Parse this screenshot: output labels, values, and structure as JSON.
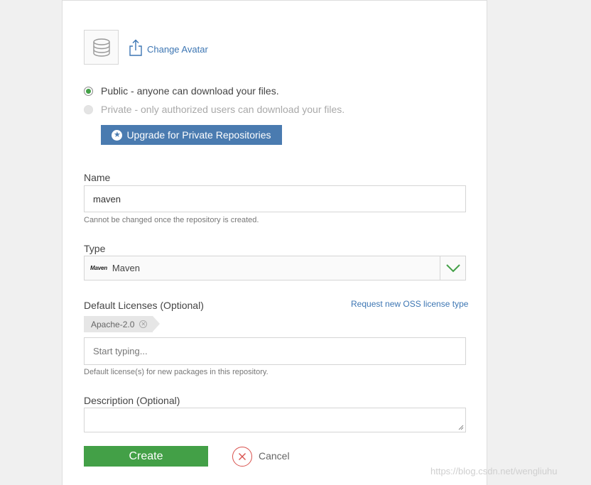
{
  "avatar": {
    "icon": "database-icon",
    "change_label": "Change Avatar"
  },
  "visibility": {
    "public_label": "Public - anyone can download your files.",
    "public_selected": true,
    "private_label": "Private - only authorized users can download your files.",
    "private_enabled": false,
    "upgrade_label": "Upgrade for Private Repositories"
  },
  "name": {
    "label": "Name",
    "value": "maven",
    "hint": "Cannot be changed once the repository is created."
  },
  "type": {
    "label": "Type",
    "logo_text": "Maven",
    "value": "Maven"
  },
  "licenses": {
    "label": "Default Licenses (Optional)",
    "request_link": "Request new OSS license type",
    "tags": [
      "Apache-2.0"
    ],
    "placeholder": "Start typing...",
    "hint": "Default license(s) for new packages in this repository."
  },
  "description": {
    "label": "Description (Optional)",
    "value": ""
  },
  "actions": {
    "create_label": "Create",
    "cancel_label": "Cancel"
  },
  "watermark": "https://blog.csdn.net/wengliuhu",
  "colors": {
    "accent_green": "#43a047",
    "link_blue": "#3d76b3",
    "upgrade_blue": "#4a7bb0",
    "cancel_red": "#d9534f"
  }
}
